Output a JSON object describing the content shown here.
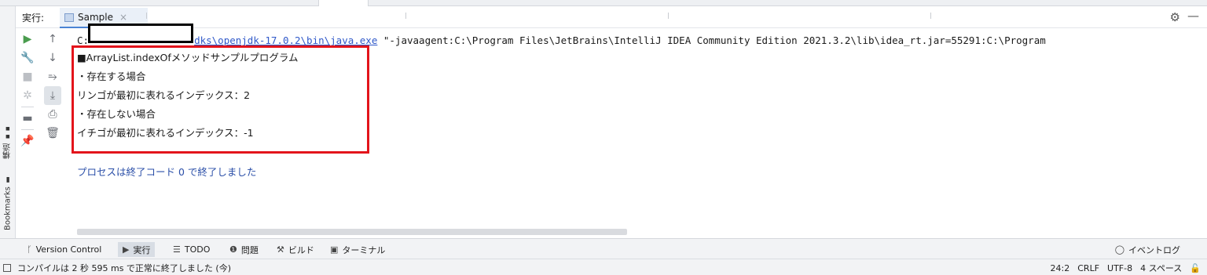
{
  "run_panel": {
    "run_label": "実行:",
    "tab_name": "Sample",
    "tab_close": "×"
  },
  "toolbar_icons": {
    "col1": [
      "run-icon",
      "wrench-icon",
      "stop-icon",
      "debug-bug-icon",
      "layout-icon",
      "pin-icon"
    ],
    "col2": [
      "arrow-up-icon",
      "arrow-down-icon",
      "soft-wrap-icon",
      "scroll-to-end-icon",
      "print-icon",
      "trash-icon"
    ]
  },
  "console": {
    "cmd_prefix": "C:",
    "cmd_link": "dks\\openjdk-17.0.2\\bin\\java.exe",
    "cmd_rest": " \"-javaagent:C:\\Program Files\\JetBrains\\IntelliJ IDEA Community Edition 2021.3.2\\lib\\idea_rt.jar=55291:C:\\Program",
    "output": {
      "line1": "■ArrayList.indexOfメソッドサンプルプログラム",
      "line2": "・存在する場合",
      "line3": "リンゴが最初に表れるインデックス：2",
      "line4": "・存在しない場合",
      "line5": "イチゴが最初に表れるインデックス：-1"
    },
    "process_done": "プロセスは終了コード 0 で終了しました"
  },
  "side_tabs": {
    "structure": "構造",
    "bookmarks": "Bookmarks"
  },
  "bottom_tools": {
    "vcs": "Version Control",
    "run": "実行",
    "todo": "TODO",
    "problems": "問題",
    "build": "ビルド",
    "terminal": "ターミナル",
    "events": "イベントログ"
  },
  "status": {
    "message": "コンパイルは 2 秒 595 ms で正常に終了しました (今)",
    "position": "24:2",
    "line_sep": "CRLF",
    "encoding": "UTF-8",
    "indent": "4 スペース"
  },
  "colors": {
    "accent": "#4a83d4",
    "link": "#2f58c9",
    "highlight": "#e3141b",
    "process_text": "#2b4fa8",
    "run_green": "#4a9c4e"
  }
}
